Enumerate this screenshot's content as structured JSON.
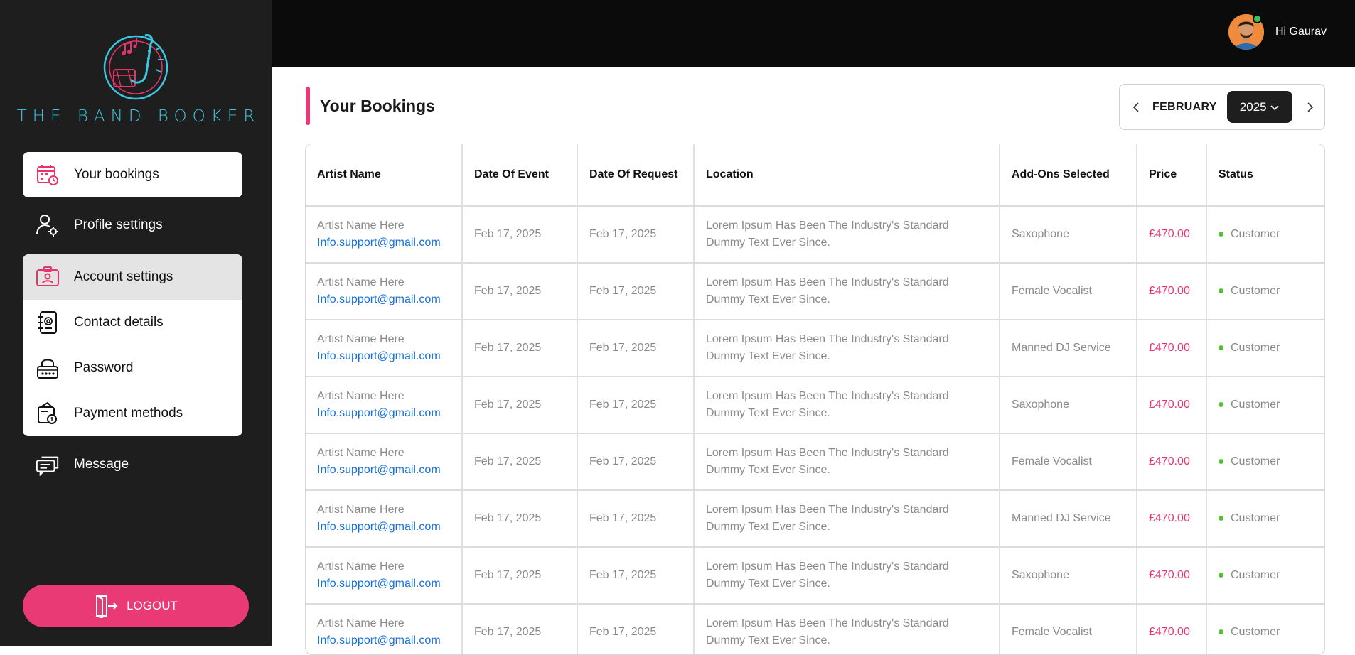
{
  "brand": {
    "name": "THE BAND BOOKER"
  },
  "sidebar": {
    "items": [
      {
        "label": "Your bookings",
        "icon": "calendar-clock-icon"
      },
      {
        "label": "Profile settings",
        "icon": "user-gear-icon"
      }
    ],
    "submenu": [
      {
        "label": "Account settings",
        "icon": "id-card-icon"
      },
      {
        "label": "Contact details",
        "icon": "address-book-icon"
      },
      {
        "label": "Password",
        "icon": "lock-icon"
      },
      {
        "label": "Payment methods",
        "icon": "wallet-icon"
      }
    ],
    "message": {
      "label": "Message",
      "icon": "chat-icon"
    },
    "logout": {
      "label": "LOGOUT",
      "icon": "logout-door-icon"
    }
  },
  "header": {
    "greeting": "Hi Gaurav"
  },
  "page": {
    "title": "Your Bookings"
  },
  "picker": {
    "month": "FEBRUARY",
    "year": "2025"
  },
  "table": {
    "headers": [
      "Artist Name",
      "Date Of Event",
      "Date Of Request",
      "Location",
      "Add-Ons Selected",
      "Price",
      "Status"
    ],
    "rows": [
      {
        "artist": "Artist Name Here",
        "email": "Info.support@gmail.com",
        "event": "Feb 17, 2025",
        "request": "Feb 17, 2025",
        "location": "Lorem Ipsum Has Been The Industry's Standard Dummy Text Ever Since.",
        "addons": "Saxophone",
        "price": "£470.00",
        "status": "Customer"
      },
      {
        "artist": "Artist Name Here",
        "email": "Info.support@gmail.com",
        "event": "Feb 17, 2025",
        "request": "Feb 17, 2025",
        "location": "Lorem Ipsum Has Been The Industry's Standard Dummy Text Ever Since.",
        "addons": "Female Vocalist",
        "price": "£470.00",
        "status": "Customer"
      },
      {
        "artist": "Artist Name Here",
        "email": "Info.support@gmail.com",
        "event": "Feb 17, 2025",
        "request": "Feb 17, 2025",
        "location": "Lorem Ipsum Has Been The Industry's Standard Dummy Text Ever Since.",
        "addons": "Manned DJ Service",
        "price": "£470.00",
        "status": "Customer"
      },
      {
        "artist": "Artist Name Here",
        "email": "Info.support@gmail.com",
        "event": "Feb 17, 2025",
        "request": "Feb 17, 2025",
        "location": "Lorem Ipsum Has Been The Industry's Standard Dummy Text Ever Since.",
        "addons": "Saxophone",
        "price": "£470.00",
        "status": "Customer"
      },
      {
        "artist": "Artist Name Here",
        "email": "Info.support@gmail.com",
        "event": "Feb 17, 2025",
        "request": "Feb 17, 2025",
        "location": "Lorem Ipsum Has Been The Industry's Standard Dummy Text Ever Since.",
        "addons": "Female Vocalist",
        "price": "£470.00",
        "status": "Customer"
      },
      {
        "artist": "Artist Name Here",
        "email": "Info.support@gmail.com",
        "event": "Feb 17, 2025",
        "request": "Feb 17, 2025",
        "location": "Lorem Ipsum Has Been The Industry's Standard Dummy Text Ever Since.",
        "addons": "Manned DJ Service",
        "price": "£470.00",
        "status": "Customer"
      },
      {
        "artist": "Artist Name Here",
        "email": "Info.support@gmail.com",
        "event": "Feb 17, 2025",
        "request": "Feb 17, 2025",
        "location": "Lorem Ipsum Has Been The Industry's Standard Dummy Text Ever Since.",
        "addons": "Saxophone",
        "price": "£470.00",
        "status": "Customer"
      },
      {
        "artist": "Artist Name Here",
        "email": "Info.support@gmail.com",
        "event": "Feb 17, 2025",
        "request": "Feb 17, 2025",
        "location": "Lorem Ipsum Has Been The Industry's Standard Dummy Text Ever Since.",
        "addons": "Female Vocalist",
        "price": "£470.00",
        "status": "Customer"
      }
    ]
  },
  "colors": {
    "accent": "#ea3a76",
    "sidebar": "#1e1e1e",
    "topbar": "#0b0b0b",
    "logo": "#3cc6e0",
    "link": "#1a6fd6",
    "status": "#55c234"
  }
}
